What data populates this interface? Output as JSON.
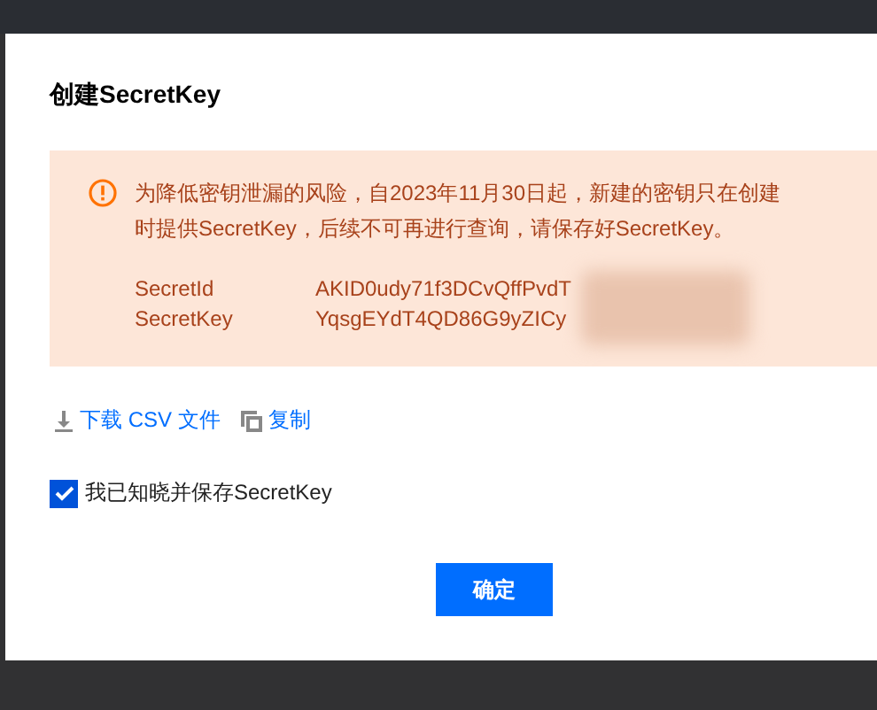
{
  "dialog": {
    "title": "创建SecretKey",
    "alert": {
      "message": "为降低密钥泄漏的风险，自2023年11月30日起，新建的密钥只在创建时提供SecretKey，后续不可再进行查询，请保存好SecretKey。",
      "fields": [
        {
          "label": "SecretId",
          "value": "AKID0udy71f3DCvQffPvdT"
        },
        {
          "label": "SecretKey",
          "value": "YqsgEYdT4QD86G9yZICy"
        }
      ]
    },
    "actions": [
      {
        "kind": "download",
        "label": "下载 CSV 文件"
      },
      {
        "kind": "copy",
        "label": "复制"
      }
    ],
    "acknowledge": {
      "label": "我已知晓并保存SecretKey",
      "checked": true
    },
    "confirm_button": "确定"
  }
}
